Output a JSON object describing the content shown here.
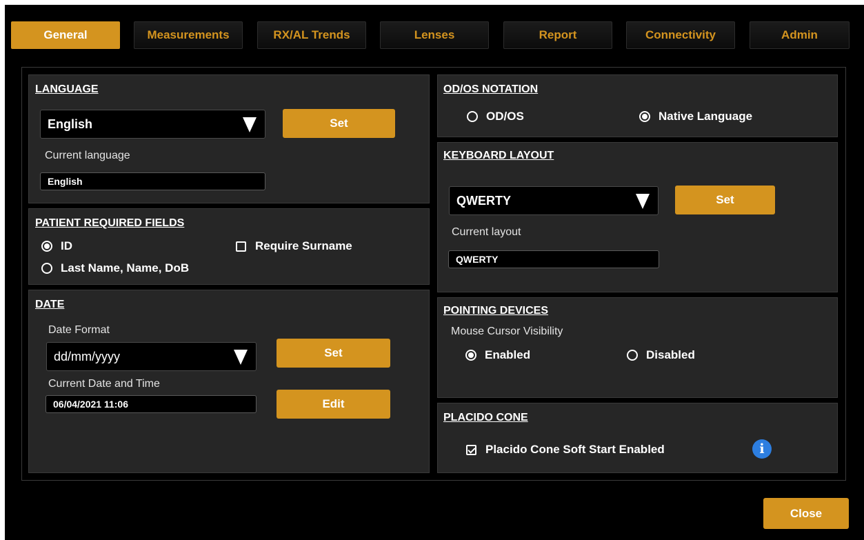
{
  "tabs": [
    {
      "label": "General",
      "active": true
    },
    {
      "label": "Measurements"
    },
    {
      "label": "RX/AL Trends"
    },
    {
      "label": "Lenses"
    },
    {
      "label": "Report"
    },
    {
      "label": "Connectivity"
    },
    {
      "label": "Admin"
    }
  ],
  "language": {
    "title": "LANGUAGE",
    "selected": "English",
    "set_label": "Set",
    "current_label": "Current language",
    "current_value": "English"
  },
  "patient_fields": {
    "title": "PATIENT REQUIRED FIELDS",
    "option_id": "ID",
    "option_name": "Last Name, Name, DoB",
    "require_surname": "Require Surname",
    "selected": "ID",
    "require_surname_checked": false
  },
  "date": {
    "title": "DATE",
    "format_label": "Date Format",
    "format_value": "dd/mm/yyyy",
    "set_label": "Set",
    "current_label": "Current Date and Time",
    "current_value": "06/04/2021 11:06",
    "edit_label": "Edit"
  },
  "notation": {
    "title": "OD/OS NOTATION",
    "option_odos": "OD/OS",
    "option_native": "Native Language",
    "selected": "Native Language"
  },
  "keyboard": {
    "title": "KEYBOARD LAYOUT",
    "selected": "QWERTY",
    "set_label": "Set",
    "current_label": "Current layout",
    "current_value": "QWERTY"
  },
  "pointing": {
    "title": "POINTING DEVICES",
    "visibility_label": "Mouse Cursor Visibility",
    "option_enabled": "Enabled",
    "option_disabled": "Disabled",
    "selected": "Enabled"
  },
  "placido": {
    "title": "PLACIDO CONE",
    "soft_start_label": "Placido Cone Soft Start Enabled",
    "soft_start_checked": true,
    "info_glyph": "i"
  },
  "close_label": "Close",
  "colors": {
    "accent": "#d4941f",
    "panel": "#262626",
    "background": "#000000",
    "info": "#2d7ee0"
  }
}
